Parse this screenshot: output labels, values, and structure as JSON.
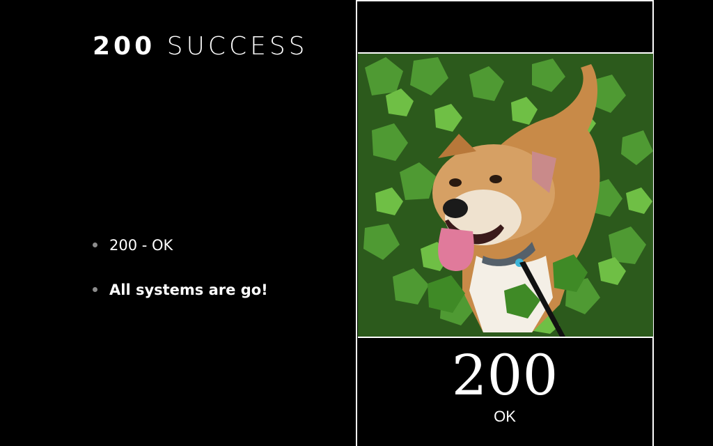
{
  "slide": {
    "title_code": "200",
    "title_word": "SUCCESS",
    "bullets": [
      {
        "text": "200 - OK"
      },
      {
        "text": "All systems are go!"
      }
    ]
  },
  "poster": {
    "code": "200",
    "text": "OK",
    "photo_subject": "happy dog in ivy leaves"
  },
  "colors": {
    "background": "#000000",
    "text": "#ffffff",
    "bullet_dot": "#8c8c8c"
  }
}
